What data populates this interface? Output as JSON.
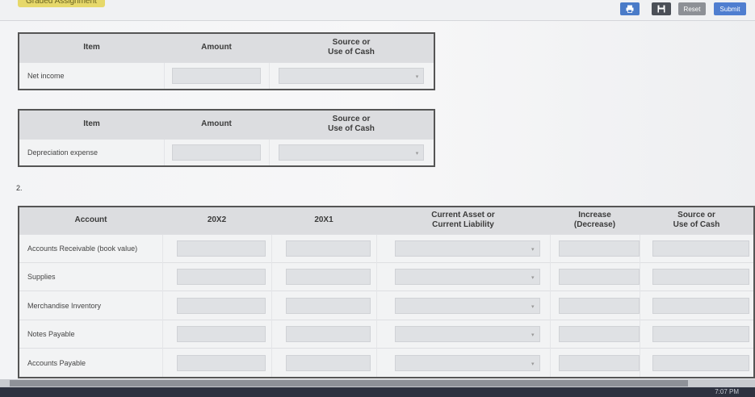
{
  "header": {
    "badge": "Graded Assignment",
    "buttons": {
      "print_icon": "printer-icon",
      "save_icon": "floppy-disk-icon",
      "reset": "Reset",
      "submit": "Submit"
    }
  },
  "table1": {
    "headers": [
      "Item",
      "Amount",
      "Source or\nUse of Cash"
    ],
    "row": {
      "item": "Net income"
    }
  },
  "table2": {
    "headers": [
      "Item",
      "Amount",
      "Source or\nUse of Cash"
    ],
    "row": {
      "item": "Depreciation expense"
    }
  },
  "section2_label": "2.",
  "table3": {
    "headers": [
      "Account",
      "20X2",
      "20X1",
      "Current Asset or\nCurrent Liability",
      "Increase\n(Decrease)",
      "Source or\nUse of Cash"
    ],
    "rows": [
      {
        "account": "Accounts Receivable (book value)"
      },
      {
        "account": "Supplies"
      },
      {
        "account": "Merchandise Inventory"
      },
      {
        "account": "Notes Payable"
      },
      {
        "account": "Accounts Payable"
      }
    ]
  },
  "taskbar": {
    "clock": "7:07 PM"
  },
  "colors": {
    "primary": "#4f7ed0",
    "dark": "#4b4f57",
    "gray": "#8d9096"
  }
}
